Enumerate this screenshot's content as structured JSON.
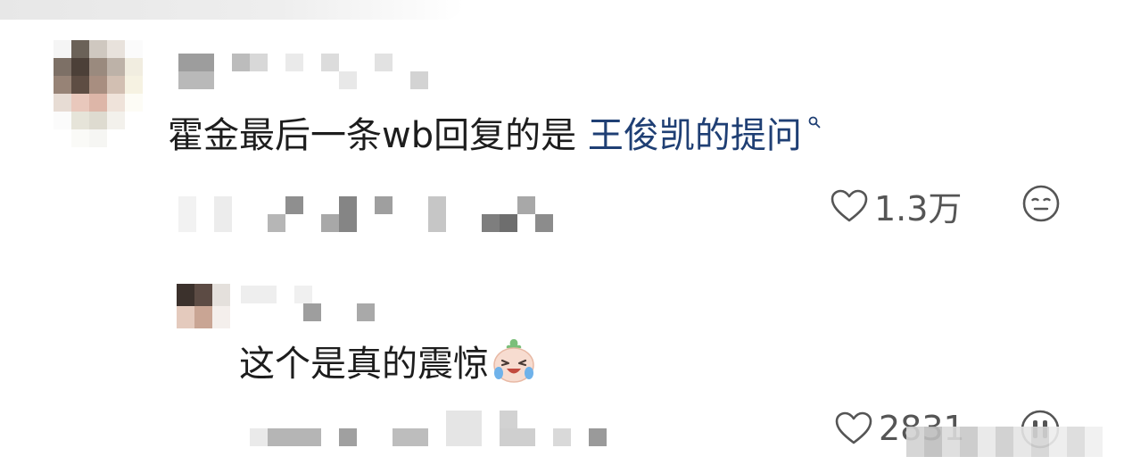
{
  "comment": {
    "text_plain": "霍金最后一条wb回复的是 ",
    "text_link": "王俊凯的提问",
    "link_color": "#1f3f74",
    "search_icon": "search-icon",
    "likes": "1.3万",
    "reaction_icon": "neutral-face-icon"
  },
  "reply": {
    "text": "这个是真的震惊",
    "emoji": "crying-laughing-emoji",
    "likes": "2831",
    "reaction_icon": "face-icon"
  }
}
